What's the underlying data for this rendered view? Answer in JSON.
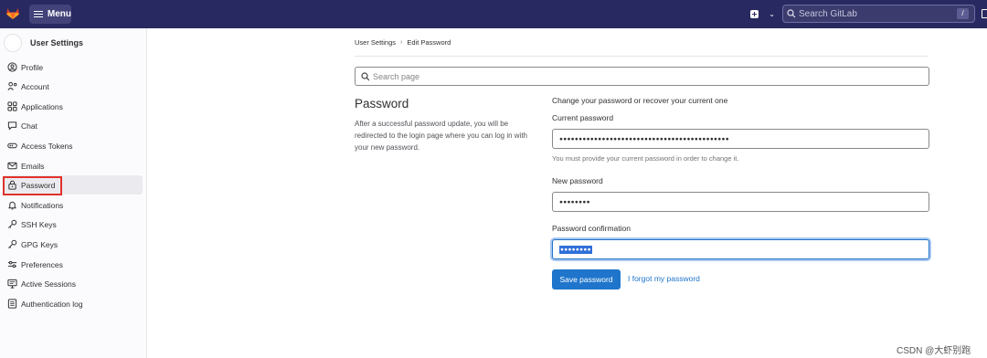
{
  "topbar": {
    "menu_label": "Menu",
    "search_placeholder": "Search GitLab",
    "search_shortcut": "/"
  },
  "sidebar": {
    "context_title": "User Settings",
    "items": [
      {
        "label": "Profile",
        "icon": "profile-icon"
      },
      {
        "label": "Account",
        "icon": "account-icon"
      },
      {
        "label": "Applications",
        "icon": "applications-icon"
      },
      {
        "label": "Chat",
        "icon": "chat-icon"
      },
      {
        "label": "Access Tokens",
        "icon": "token-icon"
      },
      {
        "label": "Emails",
        "icon": "mail-icon"
      },
      {
        "label": "Password",
        "icon": "lock-icon",
        "active": true
      },
      {
        "label": "Notifications",
        "icon": "notifications-icon"
      },
      {
        "label": "SSH Keys",
        "icon": "key-icon"
      },
      {
        "label": "GPG Keys",
        "icon": "key-icon"
      },
      {
        "label": "Preferences",
        "icon": "preferences-icon"
      },
      {
        "label": "Active Sessions",
        "icon": "monitor-icon"
      },
      {
        "label": "Authentication log",
        "icon": "log-icon"
      }
    ]
  },
  "breadcrumb": {
    "parent": "User Settings",
    "current": "Edit Password"
  },
  "page_search": {
    "placeholder": "Search page"
  },
  "section": {
    "title": "Password",
    "description": "After a successful password update, you will be redirected to the login page where you can log in with your new password."
  },
  "form": {
    "heading": "Change your password or recover your current one",
    "current_label": "Current password",
    "current_value": "●●●●●●●●●●●●●●●●●●●●●●●●●●●●●●●●●●●●●●●●●●●●",
    "current_help": "You must provide your current password in order to change it.",
    "new_label": "New password",
    "new_value": "●●●●●●●●",
    "confirm_label": "Password confirmation",
    "confirm_value": "●●●●●●●●",
    "save_label": "Save password",
    "forgot_label": "I forgot my password"
  },
  "watermark": "CSDN @大虾别跑",
  "colors": {
    "topbar": "#292961",
    "primary": "#1f75cb",
    "highlight_box": "#e0322b"
  }
}
